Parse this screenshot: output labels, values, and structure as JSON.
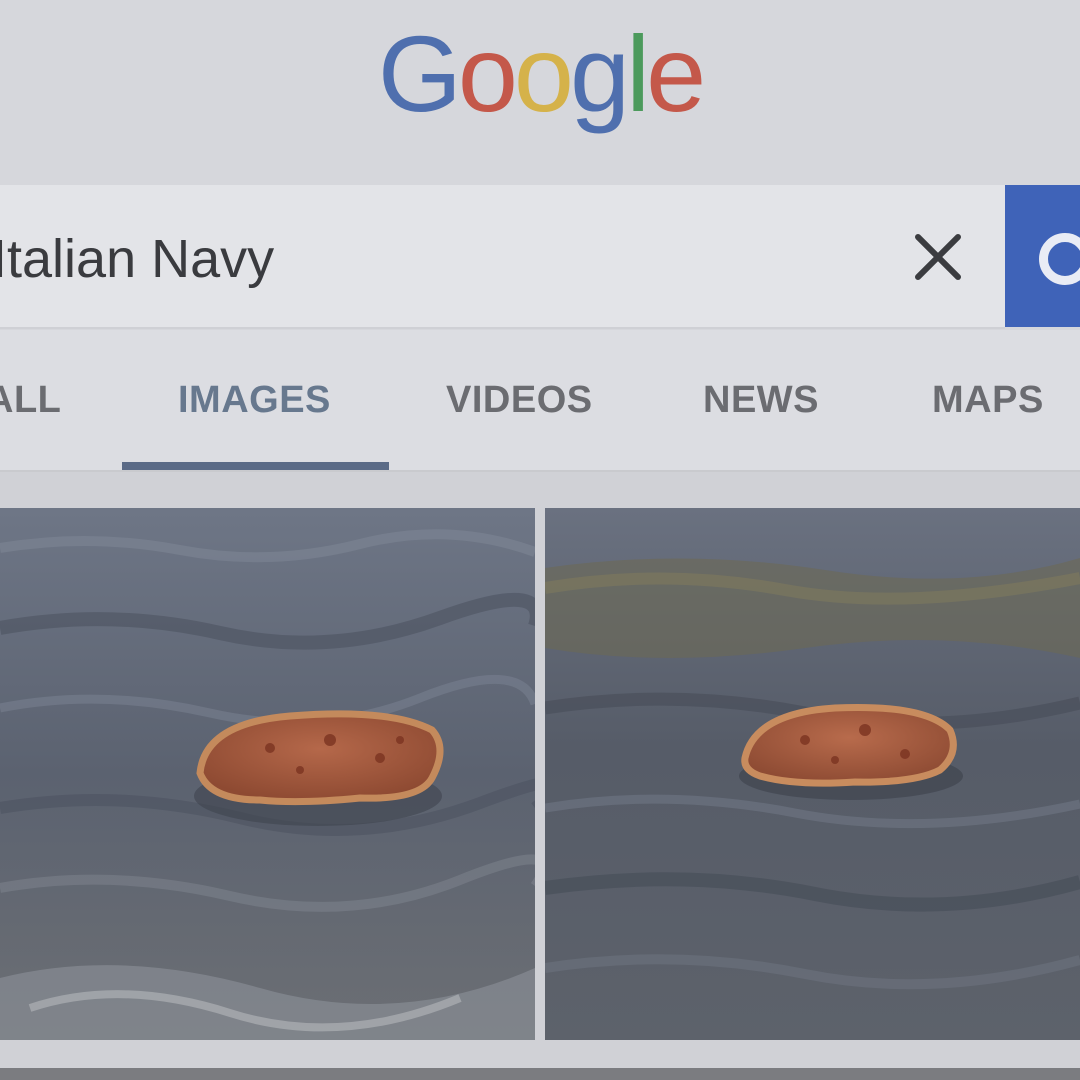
{
  "logo": {
    "letters": [
      "G",
      "o",
      "o",
      "g",
      "l",
      "e"
    ],
    "colors": [
      "#4f6fae",
      "#c4584a",
      "#d5b24a",
      "#4f6fae",
      "#4c9a5c",
      "#c4584a"
    ]
  },
  "search": {
    "query": "Italian Navy",
    "clear_icon": "close-icon",
    "search_icon": "search-icon",
    "button_color": "#3f63b8"
  },
  "tabs": [
    {
      "label": "ALL",
      "active": false
    },
    {
      "label": "IMAGES",
      "active": true
    },
    {
      "label": "VIDEOS",
      "active": false
    },
    {
      "label": "NEWS",
      "active": false
    },
    {
      "label": "MAPS",
      "active": false
    }
  ],
  "colors": {
    "active_tab": "#67788e",
    "tab_underline": "#5a6a86"
  }
}
